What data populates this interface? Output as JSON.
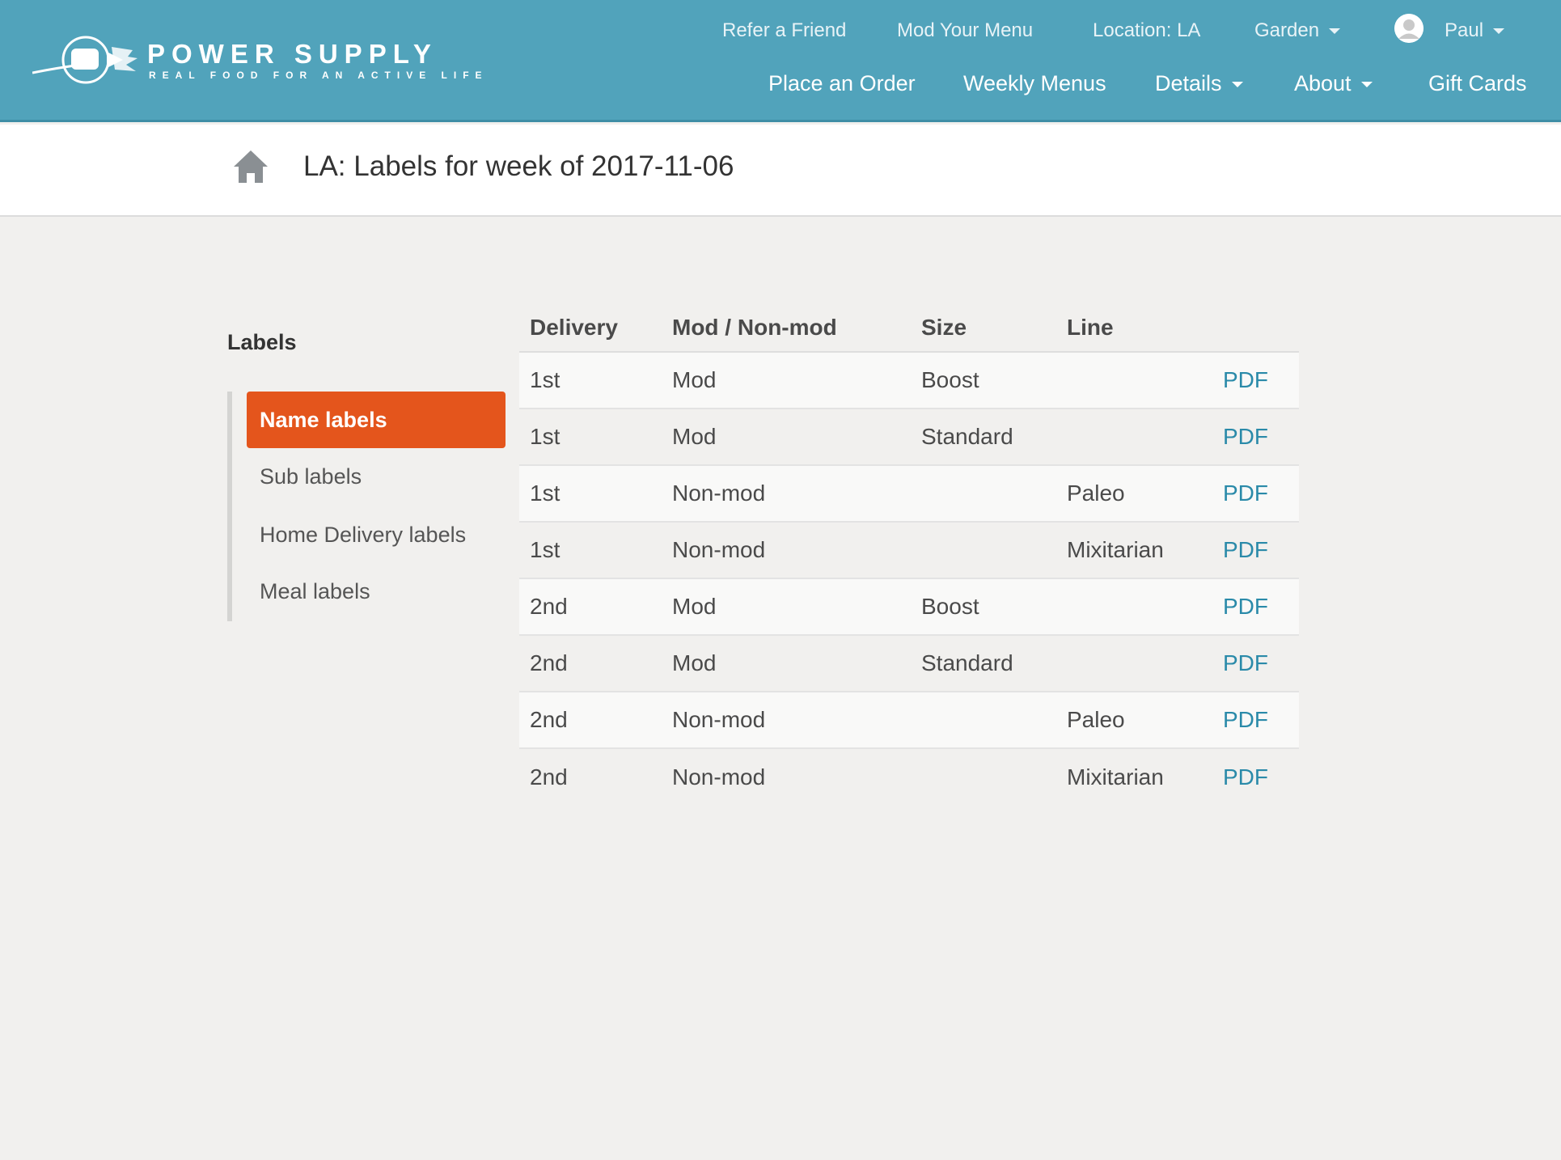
{
  "brand": {
    "name": "POWER SUPPLY",
    "tagline": "REAL FOOD FOR AN ACTIVE LIFE",
    "header_color": "#51a3bb",
    "accent_color": "#e4551c",
    "link_color": "#2a8aa9"
  },
  "nav_top": {
    "refer": "Refer a Friend",
    "mod_menu": "Mod Your Menu",
    "location": "Location: LA",
    "garden": "Garden",
    "user": "Paul"
  },
  "nav_main": {
    "order": "Place an Order",
    "menus": "Weekly Menus",
    "details": "Details",
    "about": "About",
    "gift": "Gift Cards"
  },
  "page": {
    "title": "LA: Labels for week of 2017-11-06"
  },
  "sidebar": {
    "heading": "Labels",
    "items": [
      {
        "label": "Name labels",
        "active": true
      },
      {
        "label": "Sub labels",
        "active": false
      },
      {
        "label": "Home Delivery labels",
        "active": false
      },
      {
        "label": "Meal labels",
        "active": false
      }
    ]
  },
  "table": {
    "headers": [
      "Delivery",
      "Mod / Non-mod",
      "Size",
      "Line",
      ""
    ],
    "rows": [
      {
        "delivery": "1st",
        "mod": "Mod",
        "size": "Boost",
        "line": "",
        "link": "PDF"
      },
      {
        "delivery": "1st",
        "mod": "Mod",
        "size": "Standard",
        "line": "",
        "link": "PDF"
      },
      {
        "delivery": "1st",
        "mod": "Non-mod",
        "size": "",
        "line": "Paleo",
        "link": "PDF"
      },
      {
        "delivery": "1st",
        "mod": "Non-mod",
        "size": "",
        "line": "Mixitarian",
        "link": "PDF"
      },
      {
        "delivery": "2nd",
        "mod": "Mod",
        "size": "Boost",
        "line": "",
        "link": "PDF"
      },
      {
        "delivery": "2nd",
        "mod": "Mod",
        "size": "Standard",
        "line": "",
        "link": "PDF"
      },
      {
        "delivery": "2nd",
        "mod": "Non-mod",
        "size": "",
        "line": "Paleo",
        "link": "PDF"
      },
      {
        "delivery": "2nd",
        "mod": "Non-mod",
        "size": "",
        "line": "Mixitarian",
        "link": "PDF"
      }
    ]
  },
  "icons": {
    "logo": "fist-logo-icon",
    "home": "home-icon",
    "avatar": "user-avatar-icon",
    "dropdown": "caret-down-icon"
  }
}
